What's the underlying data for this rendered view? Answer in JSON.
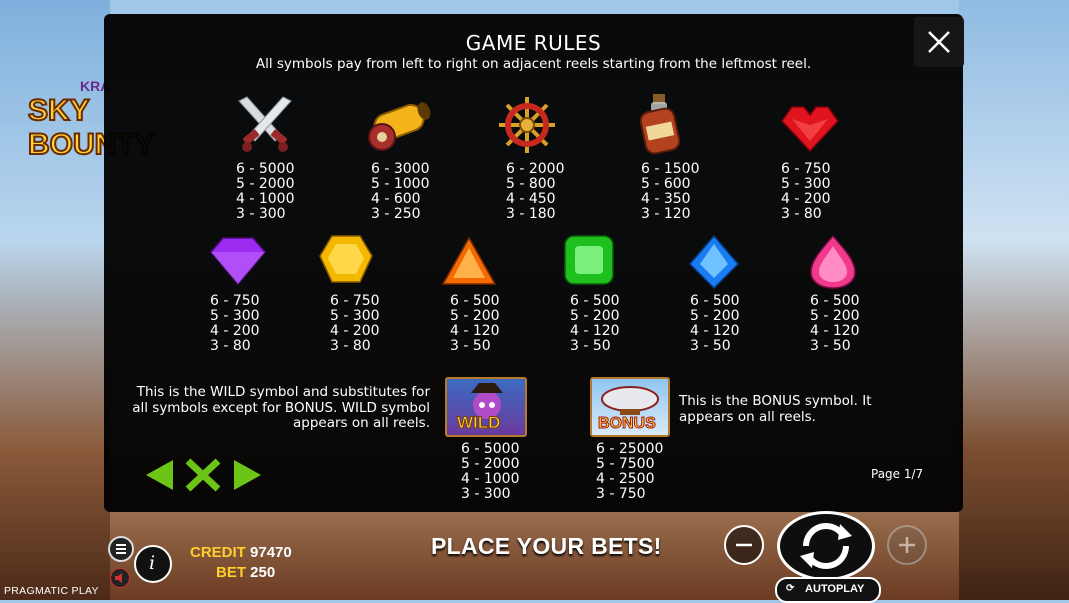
{
  "game": {
    "logo_top": "KRA",
    "logo_main": "SKY BOUNTY"
  },
  "rules": {
    "title": "GAME RULES",
    "subtitle": "All symbols pay from left to right on adjacent reels starting from the leftmost reel.",
    "row1": [
      {
        "icon": "crossed-swords-icon",
        "pays": "6 - 5000\n5 - 2000\n4 - 1000\n3 - 300"
      },
      {
        "icon": "cannon-icon",
        "pays": "6 - 3000\n5 - 1000\n4 - 600\n3 - 250"
      },
      {
        "icon": "ship-wheel-icon",
        "pays": "6 - 2000\n5 - 800\n4 - 450\n3 - 180"
      },
      {
        "icon": "rum-bottle-icon",
        "pays": "6 - 1500\n5 - 600\n4 - 350\n3 - 120"
      },
      {
        "icon": "red-heart-gem-icon",
        "pays": "6 - 750\n5 - 300\n4 - 200\n3 - 80"
      }
    ],
    "row2": [
      {
        "icon": "purple-gem-icon",
        "pays": "6 - 750\n5 - 300\n4 - 200\n3 - 80"
      },
      {
        "icon": "yellow-gem-icon",
        "pays": "6 - 750\n5 - 300\n4 - 200\n3 - 80"
      },
      {
        "icon": "orange-gem-icon",
        "pays": "6 - 500\n5 - 200\n4 - 120\n3 - 50"
      },
      {
        "icon": "green-gem-icon",
        "pays": "6 - 500\n5 - 200\n4 - 120\n3 - 50"
      },
      {
        "icon": "blue-gem-icon",
        "pays": "6 - 500\n5 - 200\n4 - 120\n3 - 50"
      },
      {
        "icon": "pink-gem-icon",
        "pays": "6 - 500\n5 - 200\n4 - 120\n3 - 50"
      }
    ],
    "wild": {
      "description": "This is the WILD symbol and substitutes for all symbols except for BONUS. WILD symbol appears on all reels.",
      "tile_label": "WILD",
      "pays": "6 - 5000\n5 - 2000\n4 - 1000\n3 - 300"
    },
    "bonus": {
      "description": "This is the BONUS symbol. It appears on all reels.",
      "tile_label": "BONUS",
      "pays": "6 - 25000\n5 - 7500\n4 - 2500\n3 - 750"
    },
    "page_indicator": "Page 1/7"
  },
  "hud": {
    "credit_label": "CREDIT",
    "credit_value": "97470",
    "bet_label": "BET",
    "bet_value": "250",
    "status_message": "PLACE YOUR BETS!",
    "autoplay_label": "AUTOPLAY",
    "provider": "PRAGMATIC PLAY"
  },
  "colors": {
    "accent_yellow": "#ffcf2e",
    "nav_green": "#6cc417",
    "modal_bg": "#020202"
  }
}
